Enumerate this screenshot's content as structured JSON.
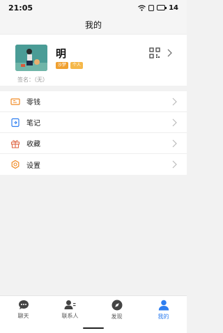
{
  "status_bar": {
    "time": "21:05",
    "battery": "14"
  },
  "header": {
    "title": "我的"
  },
  "profile": {
    "name": "明",
    "badges": [
      "沙梦",
      "个人"
    ],
    "signature": "签名：（无）"
  },
  "menu": [
    {
      "label": "零钱",
      "icon": "wallet-icon"
    },
    {
      "label": "笔记",
      "icon": "note-icon"
    },
    {
      "label": "收藏",
      "icon": "gift-icon"
    },
    {
      "label": "设置",
      "icon": "gear-icon"
    }
  ],
  "tabs": [
    {
      "label": "聊天",
      "icon": "chat-icon",
      "active": false
    },
    {
      "label": "联系人",
      "icon": "contacts-icon",
      "active": false
    },
    {
      "label": "发现",
      "icon": "compass-icon",
      "active": false
    },
    {
      "label": "我的",
      "icon": "person-icon",
      "active": true
    }
  ],
  "colors": {
    "accent": "#2e7ef0",
    "menu_icon": "#f08a24",
    "badge": "#f0a030"
  }
}
